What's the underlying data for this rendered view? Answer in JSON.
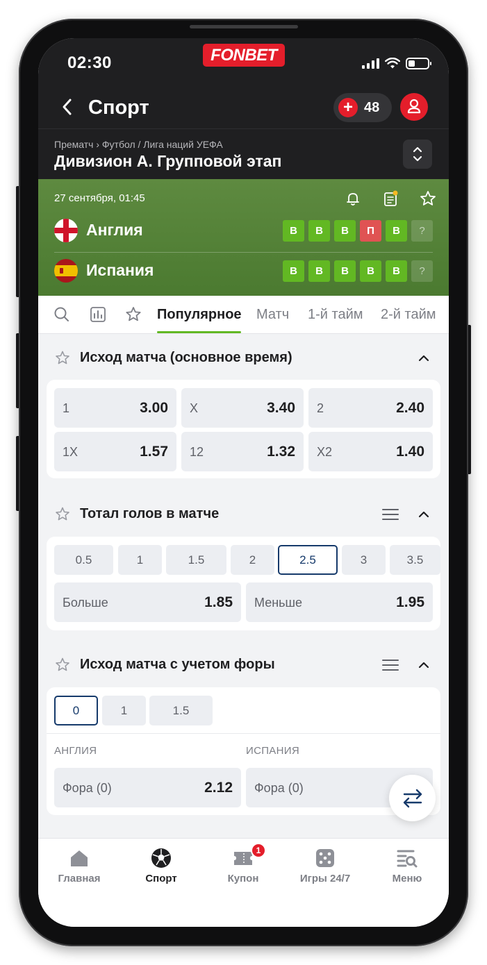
{
  "status_bar": {
    "time": "02:30",
    "brand": "FONBET"
  },
  "header": {
    "title": "Спорт",
    "bonus_count": "48"
  },
  "breadcrumb": {
    "path": "Прематч  ›  Футбол / Лига наций УЕФА",
    "title": "Дивизион А. Групповой этап"
  },
  "match": {
    "date": "27 сентября, 01:45",
    "teams": [
      {
        "name": "Англия",
        "form": [
          "В",
          "В",
          "В",
          "П",
          "В",
          "?"
        ]
      },
      {
        "name": "Испания",
        "form": [
          "В",
          "В",
          "В",
          "В",
          "В",
          "?"
        ]
      }
    ]
  },
  "tabs": [
    "Популярное",
    "Матч",
    "1-й тайм",
    "2-й тайм"
  ],
  "sections": {
    "outcome": {
      "title": "Исход матча (основное время)",
      "odds": [
        {
          "label": "1",
          "value": "3.00"
        },
        {
          "label": "X",
          "value": "3.40"
        },
        {
          "label": "2",
          "value": "2.40"
        },
        {
          "label": "1X",
          "value": "1.57"
        },
        {
          "label": "12",
          "value": "1.32"
        },
        {
          "label": "X2",
          "value": "1.40"
        }
      ]
    },
    "total": {
      "title": "Тотал голов в матче",
      "lines": [
        "0.5",
        "1",
        "1.5",
        "2",
        "2.5",
        "3",
        "3.5"
      ],
      "selected": "2.5",
      "odds": [
        {
          "label": "Больше",
          "value": "1.85"
        },
        {
          "label": "Меньше",
          "value": "1.95"
        }
      ]
    },
    "handicap": {
      "title": "Исход матча с учетом форы",
      "lines": [
        "0",
        "1",
        "1.5"
      ],
      "selected": "0",
      "team_labels": [
        "АНГЛИЯ",
        "ИСПАНИЯ"
      ],
      "odds": [
        {
          "label": "Фора (0)",
          "value": "2.12"
        },
        {
          "label": "Фора (0)",
          "value": ""
        }
      ]
    }
  },
  "bottom_nav": {
    "items": [
      "Главная",
      "Спорт",
      "Купон",
      "Игры 24/7",
      "Меню"
    ],
    "active": "Спорт",
    "coupon_badge": "1"
  },
  "colors": {
    "brand_red": "#e41e2b",
    "win_green": "#62b823",
    "loss_red": "#e05353",
    "header_green": "#5e8a40",
    "select_navy": "#163a6b"
  }
}
